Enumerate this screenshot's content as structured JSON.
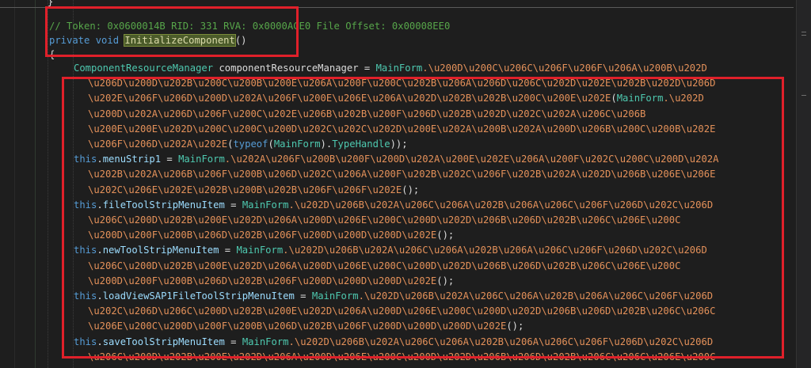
{
  "header": {
    "comment": "// Token: 0x0600014B RID: 331 RVA: 0x0000ACE0 File Offset: 0x00008EE0",
    "kw_private": "private",
    "kw_void": "void",
    "method_name": "InitializeComponent",
    "parens": "()",
    "open_brace": "{",
    "top_brace": "}"
  },
  "code_lines": [
    {
      "parts": [
        [
          "ty",
          "ComponentResourceManager"
        ],
        [
          "id",
          " componentResourceManager = "
        ],
        [
          "ty",
          "MainForm"
        ],
        [
          "esc",
          ".\\u200D\\u200C\\u206C\\u206F\\u206F\\u206A\\u200B\\u202D"
        ]
      ]
    },
    {
      "parts": [
        [
          "esc",
          "\\u206D\\u200D\\u202B\\u200C\\u200B\\u200E\\u206A\\u200F\\u200C\\u202B\\u206A\\u206D\\u206C\\u202D\\u202E\\u202B\\u202D\\u206D"
        ]
      ]
    },
    {
      "parts": [
        [
          "esc",
          "\\u202E\\u206F\\u206D\\u200D\\u202A\\u206F\\u200E\\u206E\\u206A\\u202D\\u202B\\u202B\\u200C\\u200E\\u202E"
        ],
        [
          "id",
          "("
        ],
        [
          "ty",
          "MainForm"
        ],
        [
          "esc",
          ".\\u202D"
        ]
      ]
    },
    {
      "parts": [
        [
          "esc",
          "\\u200D\\u202A\\u206D\\u206F\\u200C\\u202E\\u206B\\u202B\\u200F\\u206D\\u202B\\u202D\\u202C\\u202A\\u206C\\u206B"
        ]
      ]
    },
    {
      "parts": [
        [
          "esc",
          "\\u200E\\u200E\\u202D\\u200C\\u200C\\u200D\\u202C\\u202C\\u202D\\u200E\\u202A\\u200B\\u202A\\u200D\\u206B\\u200C\\u200B\\u202E"
        ]
      ]
    },
    {
      "parts": [
        [
          "esc",
          "\\u206F\\u206D\\u202A\\u202E"
        ],
        [
          "id",
          "("
        ],
        [
          "kw",
          "typeof"
        ],
        [
          "id",
          "("
        ],
        [
          "ty",
          "MainForm"
        ],
        [
          "id",
          ")."
        ],
        [
          "ty",
          "TypeHandle"
        ],
        [
          "id",
          "));"
        ]
      ]
    },
    {
      "parts": [
        [
          "kw",
          "this"
        ],
        [
          "id",
          "."
        ],
        [
          "prop",
          "menuStrip1"
        ],
        [
          "id",
          " = "
        ],
        [
          "ty",
          "MainForm"
        ],
        [
          "esc",
          ".\\u202A\\u206F\\u200B\\u200F\\u200D\\u202A\\u200E\\u202E\\u206A\\u200F\\u202C\\u200C\\u200D\\u202A"
        ]
      ]
    },
    {
      "parts": [
        [
          "esc",
          "\\u202B\\u202A\\u206B\\u206F\\u200B\\u206D\\u202C\\u206A\\u200F\\u202B\\u202C\\u206F\\u202B\\u202A\\u202D\\u206B\\u206E\\u206E"
        ]
      ]
    },
    {
      "parts": [
        [
          "esc",
          "\\u202C\\u206E\\u202E\\u202B\\u200B\\u202B\\u206F\\u206F\\u202E"
        ],
        [
          "id",
          "();"
        ]
      ]
    },
    {
      "parts": [
        [
          "kw",
          "this"
        ],
        [
          "id",
          "."
        ],
        [
          "prop",
          "fileToolStripMenuItem"
        ],
        [
          "id",
          " = "
        ],
        [
          "ty",
          "MainForm"
        ],
        [
          "esc",
          ".\\u202D\\u206B\\u202A\\u206C\\u206A\\u202B\\u206A\\u206C\\u206F\\u206D\\u202C\\u206D"
        ]
      ]
    },
    {
      "parts": [
        [
          "esc",
          "\\u206C\\u200D\\u202B\\u200E\\u202D\\u206A\\u200D\\u206E\\u200C\\u200D\\u202D\\u206B\\u206D\\u202B\\u206C\\u206E\\u200C"
        ]
      ]
    },
    {
      "parts": [
        [
          "esc",
          "\\u200D\\u200F\\u200B\\u206D\\u202B\\u206F\\u200D\\u200D\\u200D\\u202E"
        ],
        [
          "id",
          "();"
        ]
      ]
    },
    {
      "parts": [
        [
          "kw",
          "this"
        ],
        [
          "id",
          "."
        ],
        [
          "prop",
          "newToolStripMenuItem"
        ],
        [
          "id",
          " = "
        ],
        [
          "ty",
          "MainForm"
        ],
        [
          "esc",
          ".\\u202D\\u206B\\u202A\\u206C\\u206A\\u202B\\u206A\\u206C\\u206F\\u206D\\u202C\\u206D"
        ]
      ]
    },
    {
      "parts": [
        [
          "esc",
          "\\u206C\\u200D\\u202B\\u200E\\u202D\\u206A\\u200D\\u206E\\u200C\\u200D\\u202D\\u206B\\u206D\\u202B\\u206C\\u206E\\u200C"
        ]
      ]
    },
    {
      "parts": [
        [
          "esc",
          "\\u200D\\u200F\\u200B\\u206D\\u202B\\u206F\\u200D\\u200D\\u200D\\u202E"
        ],
        [
          "id",
          "();"
        ]
      ]
    },
    {
      "parts": [
        [
          "kw",
          "this"
        ],
        [
          "id",
          "."
        ],
        [
          "prop",
          "loadViewSAP1FileToolStripMenuItem"
        ],
        [
          "id",
          " = "
        ],
        [
          "ty",
          "MainForm"
        ],
        [
          "esc",
          ".\\u202D\\u206B\\u202A\\u206C\\u206A\\u202B\\u206A\\u206C\\u206F\\u206D"
        ]
      ]
    },
    {
      "parts": [
        [
          "esc",
          "\\u202C\\u206D\\u206C\\u200D\\u202B\\u200E\\u202D\\u206A\\u200D\\u206E\\u200C\\u200D\\u202D\\u206B\\u206D\\u202B\\u206C\\u206C"
        ]
      ]
    },
    {
      "parts": [
        [
          "esc",
          "\\u206E\\u200C\\u200D\\u200F\\u200B\\u206D\\u202B\\u206F\\u200D\\u200D\\u200D\\u202E"
        ],
        [
          "id",
          "();"
        ]
      ]
    },
    {
      "parts": [
        [
          "kw",
          "this"
        ],
        [
          "id",
          "."
        ],
        [
          "prop",
          "saveToolStripMenuItem"
        ],
        [
          "id",
          " = "
        ],
        [
          "ty",
          "MainForm"
        ],
        [
          "esc",
          ".\\u202D\\u206B\\u202A\\u206C\\u206A\\u202B\\u206A\\u206C\\u206F\\u206D\\u202C\\u206D"
        ]
      ]
    },
    {
      "parts": [
        [
          "esc",
          "\\u206C\\u200D\\u202B\\u200E\\u202D\\u206A\\u200D\\u206E\\u200C\\u200D\\u202D\\u206B\\u206D\\u202B\\u206C\\u206C\\u206E\\u200C"
        ]
      ]
    }
  ],
  "colors": {
    "background": "#1e1e1e",
    "comment": "#57a64a",
    "keyword": "#569cd6",
    "type": "#4ec9b0",
    "escape": "#e4915a",
    "highlight_box": "#e0202a"
  }
}
